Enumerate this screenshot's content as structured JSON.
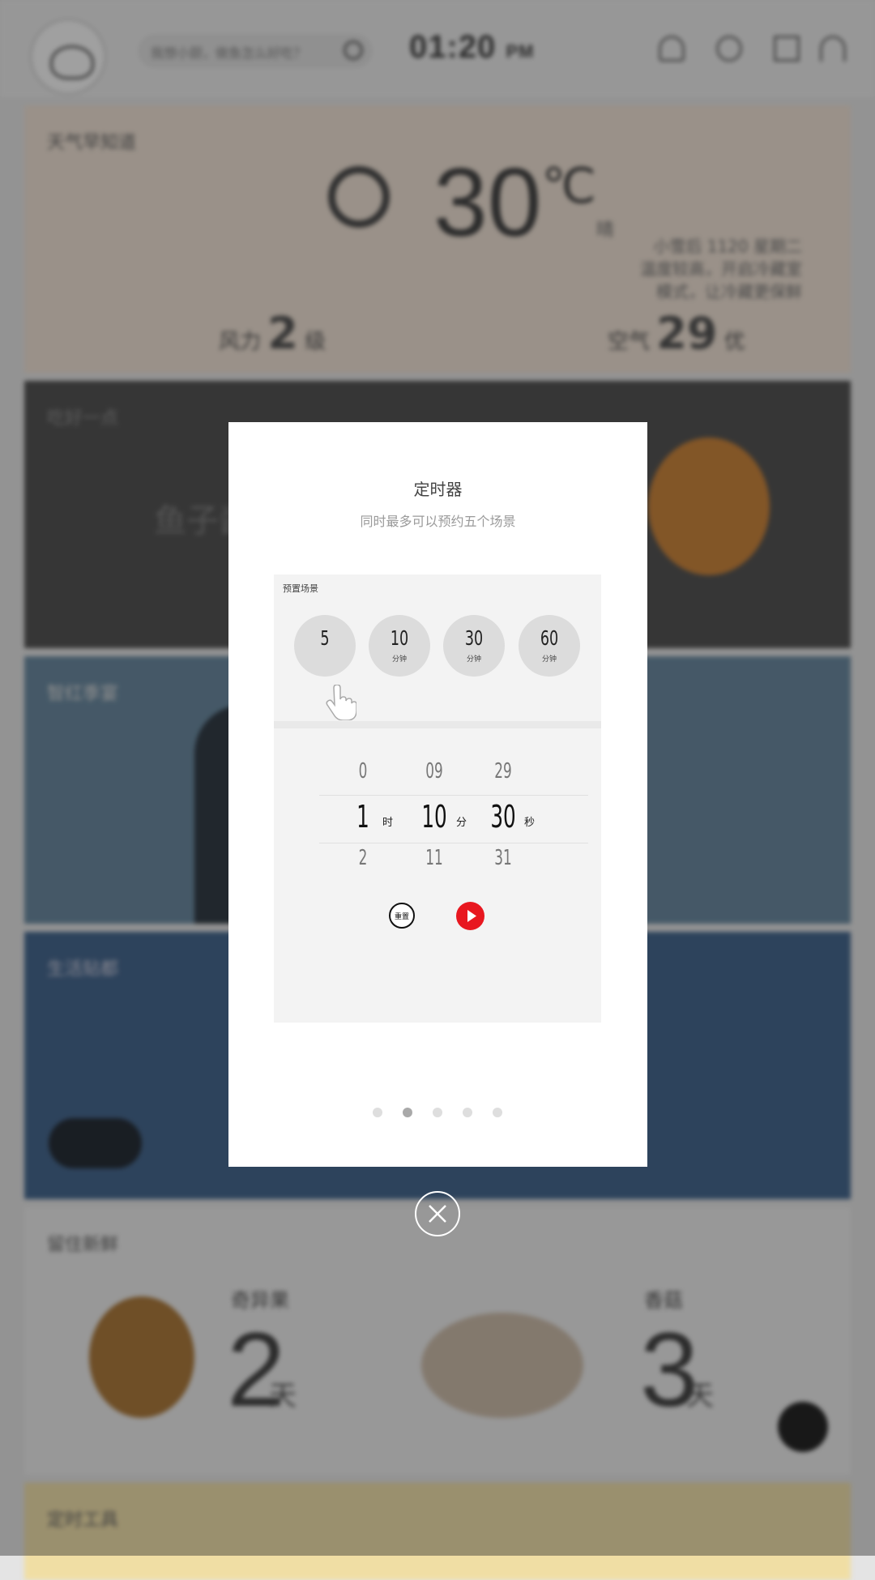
{
  "background": {
    "search_placeholder": "我想小厨，做鱼怎么好吃？",
    "clock_time": "01:20",
    "clock_ampm": "PM",
    "weather_card_title": "天气早知道",
    "weather_temp": "30",
    "weather_unit": "℃",
    "weather_desc": "晴",
    "weather_info_line1": "小雪后 1120 星期二",
    "weather_info_line2": "温度较高，开启冷藏室",
    "weather_info_line3": "模式，让冷藏更保鲜",
    "wind_label": "风力",
    "wind_value": "2",
    "wind_unit": "级",
    "air_label": "空气",
    "air_value": "29",
    "air_unit": "优",
    "dark_card_title": "吃好一点",
    "dark_card_big": "鱼子酱",
    "blue1_card_title": "智红季宴",
    "blue2_card_title": "生活贴都",
    "white1_card_title": "留住新鲜",
    "fresh1_name": "奇异果",
    "fresh1_days": "2",
    "fresh1_unit": "天",
    "fresh2_name": "香菇",
    "fresh2_days": "3",
    "fresh2_unit": "天",
    "yellow_card_title": "定时工具"
  },
  "modal": {
    "title": "定时器",
    "subtitle": "同时最多可以预约五个场景",
    "preset_label": "预置场景",
    "presets": [
      {
        "value": "5",
        "unit": ""
      },
      {
        "value": "10",
        "unit": "分钟"
      },
      {
        "value": "30",
        "unit": "分钟"
      },
      {
        "value": "60",
        "unit": "分钟"
      }
    ],
    "wheel": {
      "hours": {
        "prev": "0",
        "selected": "1",
        "next": "2",
        "unit": "时"
      },
      "minutes": {
        "prev": "09",
        "selected": "10",
        "next": "11",
        "unit": "分"
      },
      "seconds": {
        "prev": "29",
        "selected": "30",
        "next": "31",
        "unit": "秒"
      }
    },
    "reset_label": "重置",
    "play_color": "#e8171f",
    "page_count": 5,
    "active_page": 2
  },
  "colors": {
    "overlay": "rgba(35,35,35,0.42)",
    "modal_bg": "#ffffff",
    "panel_bg": "#f3f3f3",
    "accent_red": "#e8171f"
  }
}
